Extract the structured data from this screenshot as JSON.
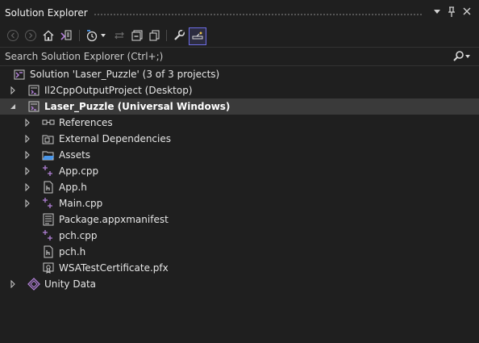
{
  "window": {
    "title": "Solution Explorer",
    "controls": [
      {
        "name": "dropdown-icon",
        "glyph": "▾"
      },
      {
        "name": "pin-icon",
        "glyph": "📌"
      },
      {
        "name": "close-icon",
        "glyph": "✕"
      }
    ]
  },
  "toolbar": {
    "buttons": [
      {
        "name": "back-icon"
      },
      {
        "name": "forward-icon"
      },
      {
        "name": "home-icon"
      },
      {
        "name": "switch-views-icon"
      },
      {
        "name": "pending-changes-filter-icon"
      },
      {
        "name": "dropdown-icon"
      },
      {
        "name": "sync-with-document-icon"
      },
      {
        "name": "collapse-all-icon"
      },
      {
        "name": "show-all-files-icon"
      },
      {
        "name": "properties-wrench-icon"
      },
      {
        "name": "preview-selected-items-icon"
      }
    ]
  },
  "search": {
    "placeholder": "Search Solution Explorer (Ctrl+;)",
    "icon": "search-icon"
  },
  "tree": [
    {
      "label": "Solution 'Laser_Puzzle' (3 of 3 projects)",
      "icon": "solution-icon",
      "indent": 0,
      "arrow": "none",
      "bold": false
    },
    {
      "label": "Il2CppOutputProject (Desktop)",
      "icon": "project-icon",
      "indent": 1,
      "arrow": "collapsed",
      "bold": false
    },
    {
      "label": "Laser_Puzzle (Universal Windows)",
      "icon": "project-icon",
      "indent": 1,
      "arrow": "expanded",
      "bold": true,
      "selected": true
    },
    {
      "label": "References",
      "icon": "references-icon",
      "indent": 2,
      "arrow": "collapsed",
      "bold": false
    },
    {
      "label": "External Dependencies",
      "icon": "external-dependencies-icon",
      "indent": 2,
      "arrow": "collapsed",
      "bold": false
    },
    {
      "label": "Assets",
      "icon": "folder-icon",
      "indent": 2,
      "arrow": "collapsed",
      "bold": false
    },
    {
      "label": "App.cpp",
      "icon": "cpp-file-icon",
      "indent": 2,
      "arrow": "collapsed",
      "bold": false
    },
    {
      "label": "App.h",
      "icon": "header-file-icon",
      "indent": 2,
      "arrow": "collapsed",
      "bold": false
    },
    {
      "label": "Main.cpp",
      "icon": "cpp-file-icon",
      "indent": 2,
      "arrow": "collapsed",
      "bold": false
    },
    {
      "label": "Package.appxmanifest",
      "icon": "manifest-file-icon",
      "indent": 2,
      "arrow": "none",
      "bold": false
    },
    {
      "label": "pch.cpp",
      "icon": "cpp-file-icon",
      "indent": 2,
      "arrow": "none",
      "bold": false
    },
    {
      "label": "pch.h",
      "icon": "header-file-icon",
      "indent": 2,
      "arrow": "none",
      "bold": false
    },
    {
      "label": "WSATestCertificate.pfx",
      "icon": "certificate-file-icon",
      "indent": 2,
      "arrow": "none",
      "bold": false
    },
    {
      "label": "Unity Data",
      "icon": "unity-data-icon",
      "indent": 0,
      "arrow": "collapsed",
      "bold": false
    }
  ],
  "colors": {
    "background": "#1f1f1f",
    "selection": "#3a3a3a",
    "accent_purple": "#b180d7",
    "text": "#e6e6e6"
  }
}
